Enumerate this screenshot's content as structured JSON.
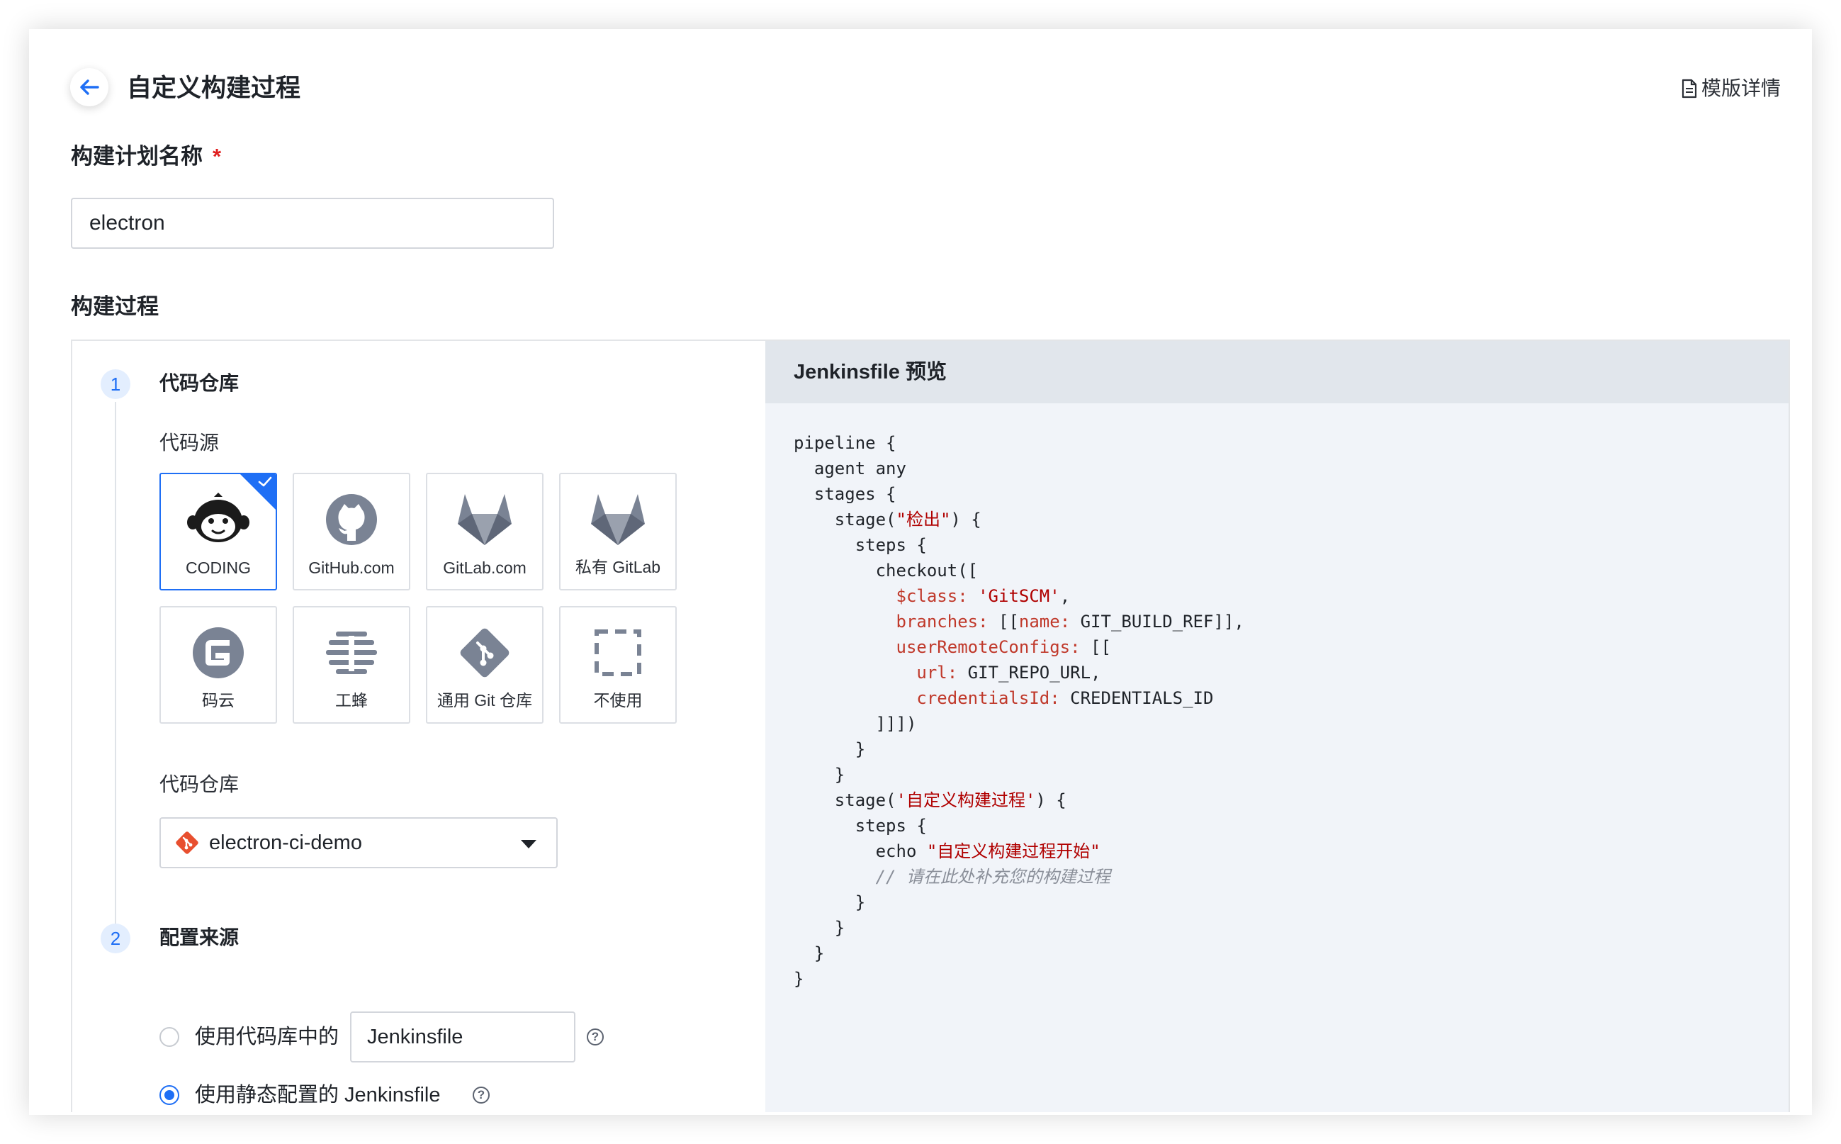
{
  "header": {
    "title": "自定义构建过程",
    "template_link": "模版详情"
  },
  "plan_name": {
    "label": "构建计划名称",
    "required_mark": "*",
    "value": "electron"
  },
  "build_process": {
    "label": "构建过程",
    "step1": {
      "number": "1",
      "title": "代码仓库",
      "source_label": "代码源",
      "sources": [
        {
          "label": "CODING",
          "icon": "coding-icon",
          "selected": true
        },
        {
          "label": "GitHub.com",
          "icon": "github-icon",
          "selected": false
        },
        {
          "label": "GitLab.com",
          "icon": "gitlab-icon",
          "selected": false
        },
        {
          "label": "私有 GitLab",
          "icon": "gitlab-icon",
          "selected": false
        },
        {
          "label": "码云",
          "icon": "gitee-icon",
          "selected": false
        },
        {
          "label": "工蜂",
          "icon": "gongfeng-icon",
          "selected": false
        },
        {
          "label": "通用 Git 仓库",
          "icon": "git-icon",
          "selected": false
        },
        {
          "label": "不使用",
          "icon": "none-icon",
          "selected": false
        }
      ],
      "repo_label": "代码仓库",
      "repo_value": "electron-ci-demo"
    },
    "step2": {
      "number": "2",
      "title": "配置来源",
      "option1_label": "使用代码库中的",
      "option1_input": "Jenkinsfile",
      "option2_label": "使用静态配置的 Jenkinsfile",
      "selected": "option2"
    }
  },
  "preview": {
    "title": "Jenkinsfile 预览",
    "code": {
      "l1": "pipeline {",
      "l2": "  agent any",
      "l3": "  stages {",
      "l4a": "    stage(",
      "l4b": "\"检出\"",
      "l4c": ") {",
      "l5": "      steps {",
      "l6": "        checkout([",
      "l7a": "          $class:",
      "l7b": " 'GitSCM'",
      "l7c": ",",
      "l8a": "          branches:",
      "l8b": " [[",
      "l8c": "name:",
      "l8d": " GIT_BUILD_REF]],",
      "l9a": "          userRemoteConfigs:",
      "l9b": " [[",
      "l10a": "            url:",
      "l10b": " GIT_REPO_URL,",
      "l11a": "            credentialsId:",
      "l11b": " CREDENTIALS_ID",
      "l12": "        ]]])",
      "l13": "      }",
      "l14": "    }",
      "l15a": "    stage(",
      "l15b": "'自定义构建过程'",
      "l15c": ") {",
      "l16": "      steps {",
      "l17a": "        echo ",
      "l17b": "\"自定义构建过程开始\"",
      "l18": "        // 请在此处补充您的构建过程",
      "l19": "      }",
      "l20": "    }",
      "l21": "  }",
      "l22": "}"
    }
  },
  "colors": {
    "accent": "#1f6ff5",
    "required": "#e02020",
    "code_keyword": "#c0392b",
    "code_string": "#b00000",
    "code_comment": "#8a8f99",
    "preview_bg": "#f1f4f9",
    "preview_header_bg": "#e1e6ec",
    "icon_gray": "#7a8394"
  }
}
